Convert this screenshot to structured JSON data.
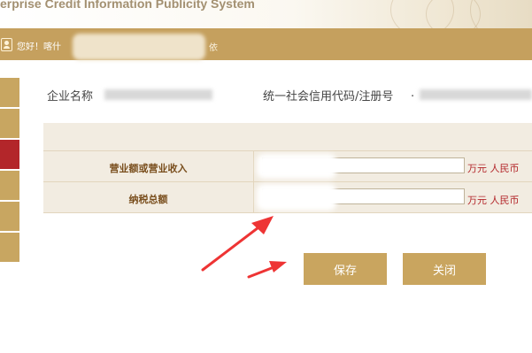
{
  "banner": {
    "title": "erprise Credit Information Publicity System"
  },
  "user_bar": {
    "greeting": "您好！喀什",
    "suffix": "依"
  },
  "company_info": {
    "name_label": "企业名称",
    "code_label": "统一社会信用代码/注册号",
    "code_separator": "."
  },
  "form": {
    "rows": [
      {
        "label": "营业额或营业收入",
        "value": "",
        "unit": "万元 人民币"
      },
      {
        "label": "纳税总额",
        "value": "",
        "unit": "万元 人民币"
      }
    ]
  },
  "buttons": {
    "save": "保存",
    "close": "关闭"
  },
  "colors": {
    "accent": "#c5a05e",
    "active_tab": "#b3262a",
    "unit_text": "#b3262a",
    "annotation_arrow": "#ee3434"
  }
}
